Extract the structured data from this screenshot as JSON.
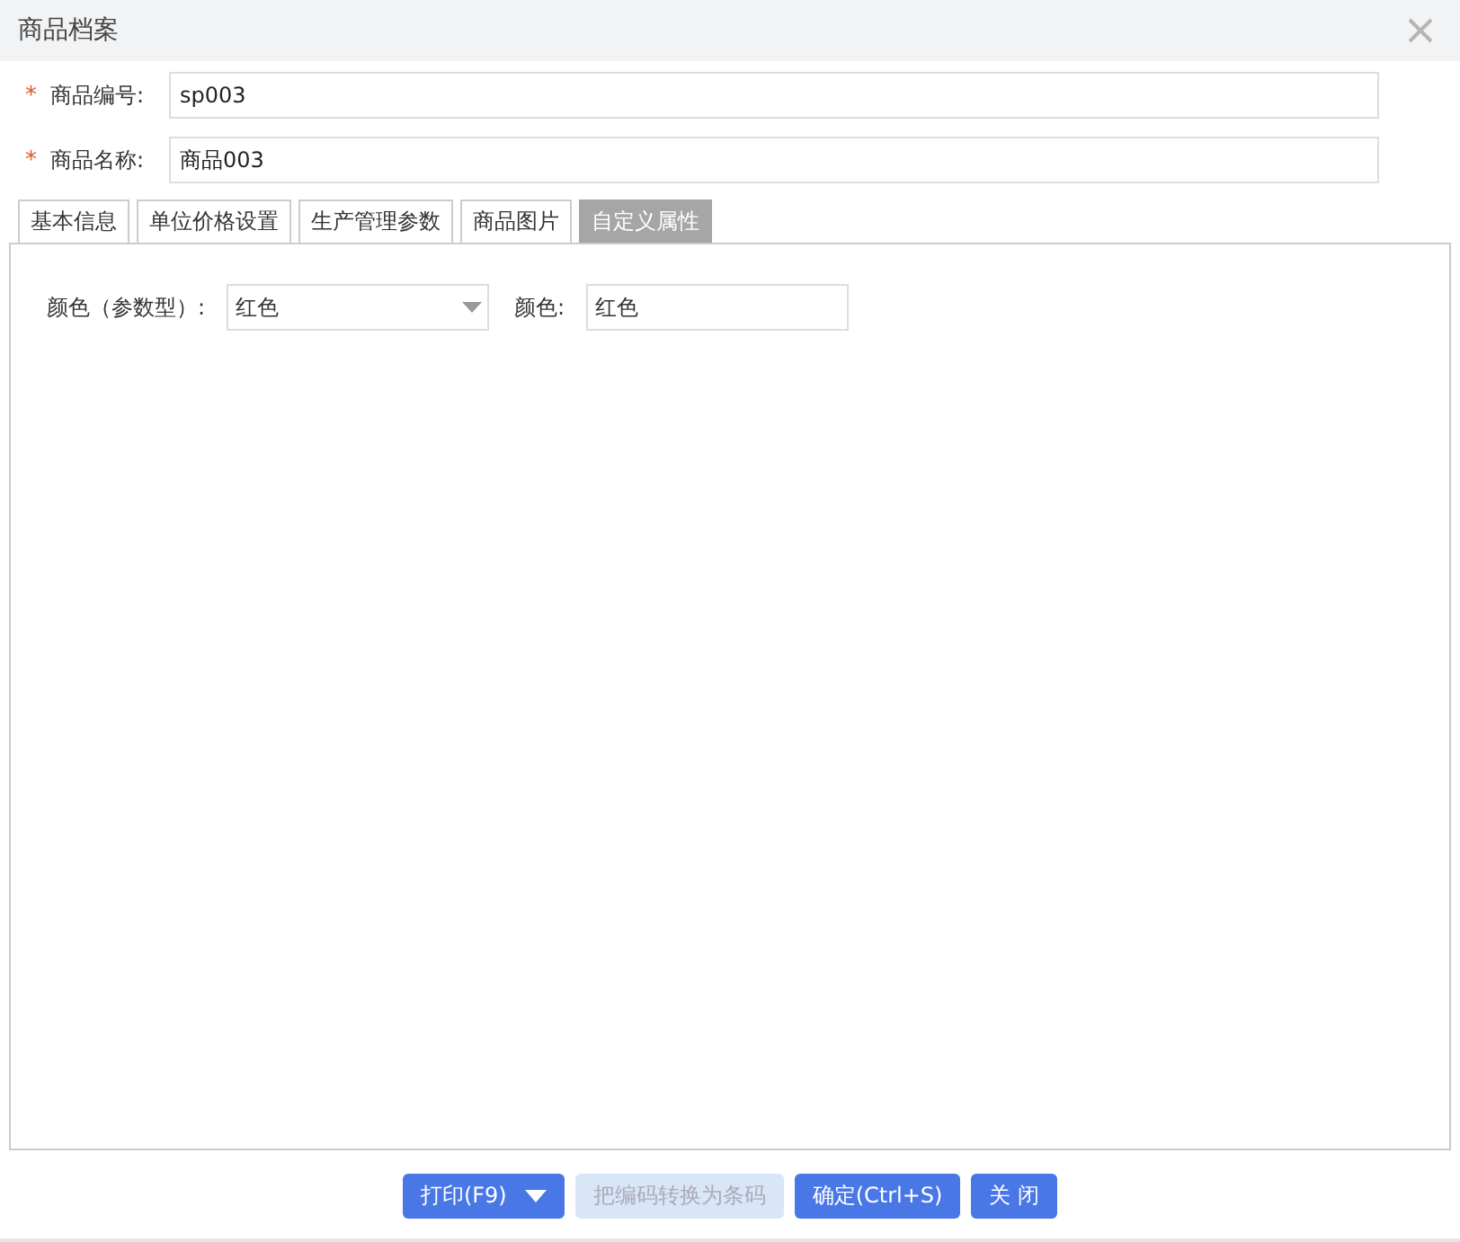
{
  "window": {
    "title": "商品档案"
  },
  "fields": [
    {
      "required_mark": "*",
      "label": "商品编号:",
      "value": "sp003"
    },
    {
      "required_mark": "*",
      "label": "商品名称:",
      "value": "商品003"
    }
  ],
  "tabs": [
    {
      "label": "基本信息",
      "selected": false
    },
    {
      "label": "单位价格设置",
      "selected": false
    },
    {
      "label": "生产管理参数",
      "selected": false
    },
    {
      "label": "商品图片",
      "selected": false
    },
    {
      "label": "自定义属性",
      "selected": true
    }
  ],
  "attributes": [
    {
      "kind": "select",
      "label": "颜色（参数型）:",
      "value": "红色"
    },
    {
      "kind": "text",
      "label": "颜色:",
      "value": "红色"
    }
  ],
  "buttons": [
    {
      "label": "打印(F9)",
      "disabled": false,
      "dropdown": true
    },
    {
      "label": "把编码转换为条码",
      "disabled": true,
      "dropdown": false
    },
    {
      "label": "确定(Ctrl+S)",
      "disabled": false,
      "dropdown": false
    },
    {
      "label": "关 闭",
      "disabled": false,
      "dropdown": false
    }
  ]
}
